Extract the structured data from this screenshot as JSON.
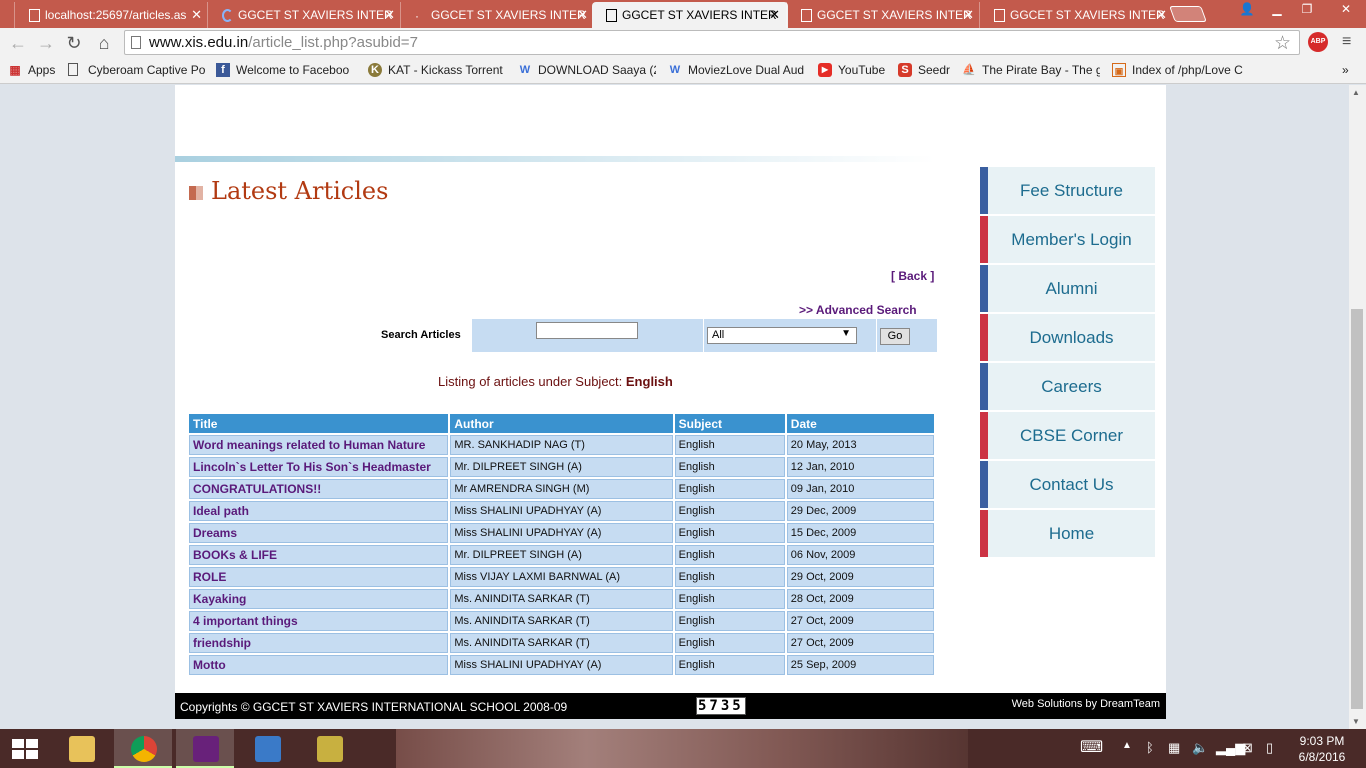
{
  "browser": {
    "tabs": [
      {
        "label": "localhost:25697/articles.as",
        "active": false
      },
      {
        "label": "GGCET ST XAVIERS INTER",
        "active": false
      },
      {
        "label": "GGCET ST XAVIERS INTER",
        "active": false
      },
      {
        "label": "GGCET ST XAVIERS INTER",
        "active": true
      },
      {
        "label": "GGCET ST XAVIERS INTER",
        "active": false
      },
      {
        "label": "GGCET ST XAVIERS INTER",
        "active": false
      }
    ],
    "url_host": "www.xis.edu.in",
    "url_path": "/article_list.php?asubid=7",
    "abp_label": "ABP",
    "bookmarks": [
      {
        "label": "Apps",
        "icon": "apps-grid-icon"
      },
      {
        "label": "Cyberoam Captive Po",
        "icon": "page-icon"
      },
      {
        "label": "Welcome to Faceboo",
        "icon": "facebook-icon"
      },
      {
        "label": "KAT - Kickass Torrent",
        "icon": "kat-icon"
      },
      {
        "label": "DOWNLOAD Saaya (2",
        "icon": "w-icon"
      },
      {
        "label": "MoviezLove Dual Aud",
        "icon": "w-icon"
      },
      {
        "label": "YouTube",
        "icon": "youtube-icon"
      },
      {
        "label": "Seedr",
        "icon": "seedr-icon"
      },
      {
        "label": "The Pirate Bay - The g",
        "icon": "pirate-ship-icon"
      },
      {
        "label": "Index of /php/Love C",
        "icon": "folder-icon"
      }
    ]
  },
  "content": {
    "heading": "Latest Articles",
    "back_link": "[ Back ]",
    "advanced_search": ">> Advanced Search",
    "search_label": "Search Articles",
    "search_value": "",
    "subject_selected": "All",
    "go_label": "Go",
    "listing_prefix": "Listing of articles under Subject: ",
    "listing_subject": "English",
    "table": {
      "headers": [
        "Title",
        "Author",
        "Subject",
        "Date"
      ],
      "rows": [
        [
          "Word meanings related to Human Nature",
          "MR. SANKHADIP NAG (T)",
          "English",
          "20 May, 2013"
        ],
        [
          "Lincoln`s Letter To His Son`s Headmaster",
          "Mr. DILPREET SINGH (A)",
          "English",
          "12 Jan, 2010"
        ],
        [
          "CONGRATULATIONS!!",
          "Mr AMRENDRA SINGH (M)",
          "English",
          "09 Jan, 2010"
        ],
        [
          "Ideal path",
          "Miss SHALINI UPADHYAY (A)",
          "English",
          "29 Dec, 2009"
        ],
        [
          "Dreams",
          "Miss SHALINI UPADHYAY (A)",
          "English",
          "15 Dec, 2009"
        ],
        [
          "BOOKs & LIFE",
          "Mr. DILPREET SINGH (A)",
          "English",
          "06 Nov, 2009"
        ],
        [
          "ROLE",
          "Miss VIJAY LAXMI BARNWAL (A)",
          "English",
          "29 Oct, 2009"
        ],
        [
          "Kayaking",
          "Ms. ANINDITA SARKAR (T)",
          "English",
          "28 Oct, 2009"
        ],
        [
          "4 important things",
          "Ms. ANINDITA SARKAR (T)",
          "English",
          "27 Oct, 2009"
        ],
        [
          "friendship",
          "Ms. ANINDITA SARKAR (T)",
          "English",
          "27 Oct, 2009"
        ],
        [
          "Motto",
          "Miss SHALINI UPADHYAY (A)",
          "English",
          "25 Sep, 2009"
        ]
      ]
    },
    "sidenav": [
      {
        "label": "Fee Structure",
        "accent": "#3a5fa0"
      },
      {
        "label": "Member's Login",
        "accent": "#cc3344"
      },
      {
        "label": "Alumni",
        "accent": "#3a5fa0"
      },
      {
        "label": "Downloads",
        "accent": "#cc3344"
      },
      {
        "label": "Careers",
        "accent": "#3a5fa0"
      },
      {
        "label": "CBSE Corner",
        "accent": "#cc3344"
      },
      {
        "label": "Contact Us",
        "accent": "#3a5fa0"
      },
      {
        "label": "Home",
        "accent": "#cc3344"
      }
    ],
    "footer": {
      "copyright": "Copyrights © GGCET ST XAVIERS INTERNATIONAL SCHOOL 2008-09",
      "counter": "5735",
      "credit": "Web Solutions by DreamTeam"
    }
  },
  "taskbar": {
    "apps": [
      "file-explorer-icon",
      "chrome-icon",
      "visual-studio-icon",
      "photos-icon",
      "tools-icon"
    ],
    "time": "9:03 PM",
    "date": "6/8/2016"
  },
  "colors": {
    "tab_strip": "#c35a4c",
    "heading": "#b23a12",
    "link": "#5a1a7a",
    "table_header": "#3a92cf",
    "table_cell": "#c6dcf2"
  }
}
